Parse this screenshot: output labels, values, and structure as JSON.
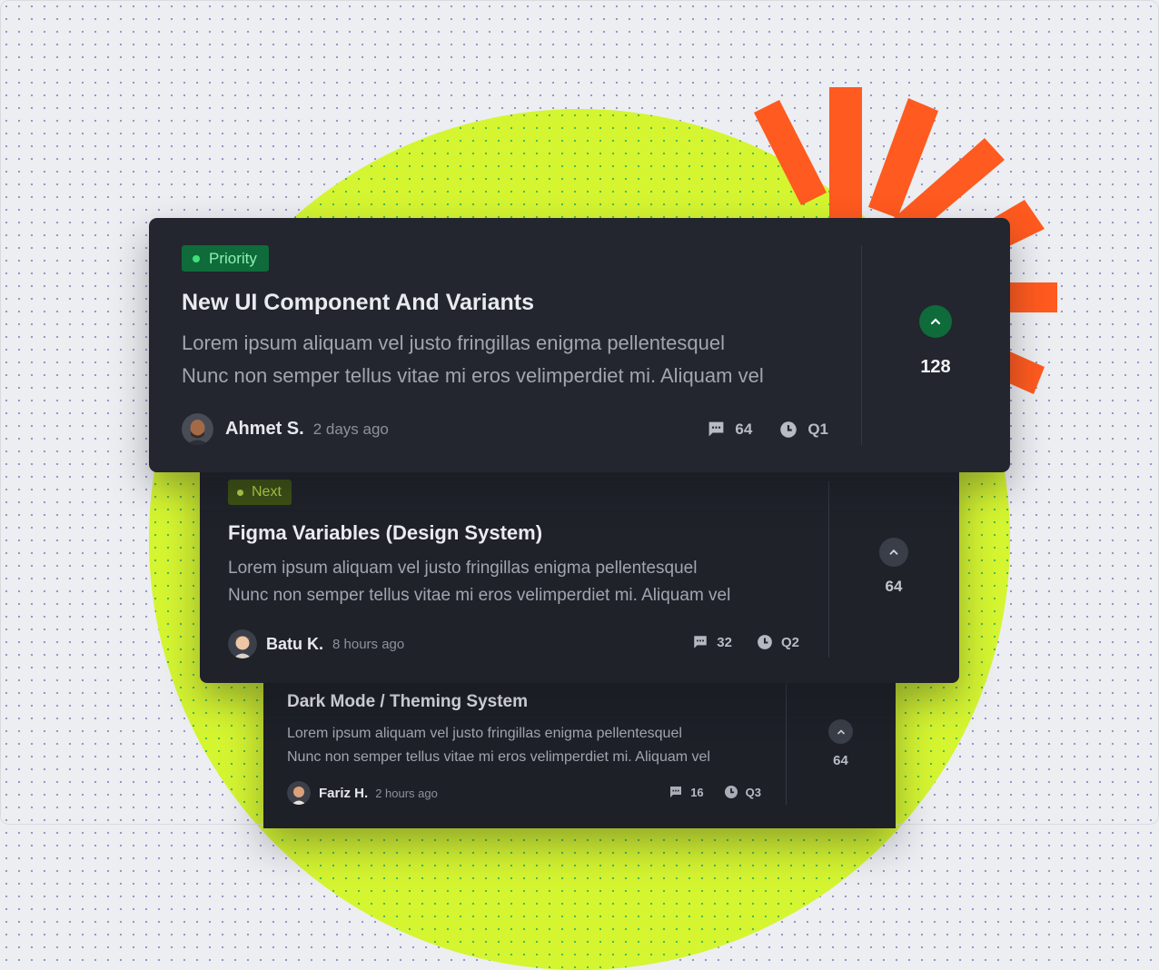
{
  "colors": {
    "background": "#eceef2",
    "blob": "#d5f531",
    "burst": "#ff5a1f",
    "card": "#23262e",
    "priority_badge": "#0f6b3a",
    "priority_text": "#8ff0b0",
    "next_badge": "#3e5214",
    "next_text": "#b6d64a",
    "vote_active": "#0f6b3a",
    "vote_inactive": "#3a3e48"
  },
  "cards": [
    {
      "badge": "Priority",
      "title": "New UI Component And Variants",
      "description_line1": "Lorem ipsum aliquam vel justo fringillas enigma pellentesquel",
      "description_line2": "Nunc non semper tellus vitae mi eros velimperdiet mi. Aliquam vel",
      "author": "Ahmet S.",
      "time": "2 days ago",
      "comments": "64",
      "quarter": "Q1",
      "votes": "128",
      "icons": {
        "comment": "comment-icon",
        "clock": "clock-icon",
        "vote": "chevron-up-icon"
      }
    },
    {
      "badge": "Next",
      "title": "Figma Variables (Design System)",
      "description_line1": "Lorem ipsum aliquam vel justo fringillas enigma pellentesquel",
      "description_line2": "Nunc non semper tellus vitae mi eros velimperdiet mi. Aliquam vel",
      "author": "Batu K.",
      "time": "8 hours ago",
      "comments": "32",
      "quarter": "Q2",
      "votes": "64"
    },
    {
      "title": "Dark Mode / Theming System",
      "description_line1": "Lorem ipsum aliquam vel justo fringillas enigma pellentesquel",
      "description_line2": "Nunc non semper tellus vitae mi eros velimperdiet mi. Aliquam vel",
      "author": "Fariz H.",
      "time": "2 hours ago",
      "comments": "16",
      "quarter": "Q3",
      "votes": "64"
    }
  ]
}
